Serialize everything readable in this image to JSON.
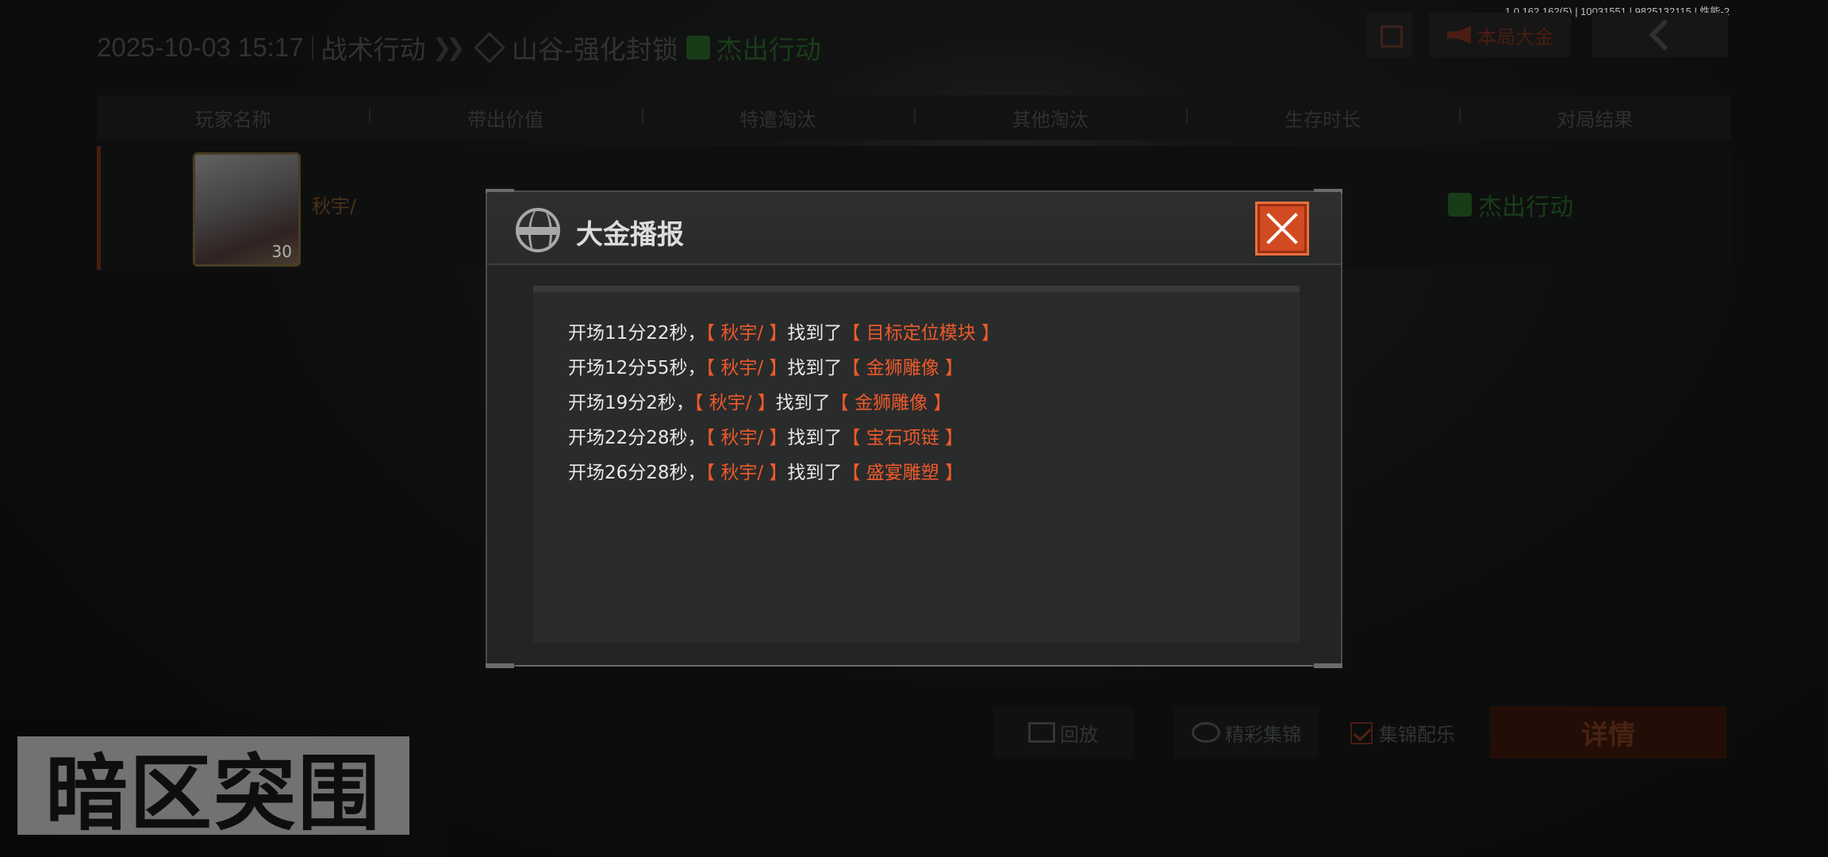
{
  "version": "1.0.162.162(5) | 10031551 | 9825132115 | 性能-2",
  "header": {
    "date": "2025-10-03 15:17",
    "mode": "战术行动",
    "map": "山谷-强化封锁",
    "result": "杰出行动"
  },
  "top_buttons": {
    "dajin_label": "本局大金"
  },
  "table": {
    "columns": [
      "玩家名称",
      "带出价值",
      "特遣淘汰",
      "其他淘汰",
      "生存时长",
      "对局结果"
    ],
    "player": {
      "name": "秋宇/",
      "level": "30",
      "result": "杰出行动"
    }
  },
  "bottom": {
    "replay_label": "回放",
    "highlights_label": "精彩集锦",
    "music_label": "集锦配乐",
    "detail_label": "详情"
  },
  "logo_text": "暗区突围",
  "modal": {
    "title": "大金播报",
    "messages": [
      {
        "time": "开场11分22秒，",
        "player": "【 秋宇/ 】",
        "verb": "找到了",
        "item": "【 目标定位模块 】"
      },
      {
        "time": "开场12分55秒，",
        "player": "【 秋宇/ 】",
        "verb": "找到了",
        "item": "【 金狮雕像 】"
      },
      {
        "time": "开场19分2秒，",
        "player": "【 秋宇/ 】",
        "verb": "找到了",
        "item": "【 金狮雕像 】"
      },
      {
        "time": "开场22分28秒，",
        "player": "【 秋宇/ 】",
        "verb": "找到了",
        "item": "【 宝石项链 】"
      },
      {
        "time": "开场26分28秒，",
        "player": "【 秋宇/ 】",
        "verb": "找到了",
        "item": "【 盛宴雕塑 】"
      }
    ]
  },
  "colors": {
    "accent_orange": "#ec5a2a",
    "close_button": "#d24a22"
  }
}
